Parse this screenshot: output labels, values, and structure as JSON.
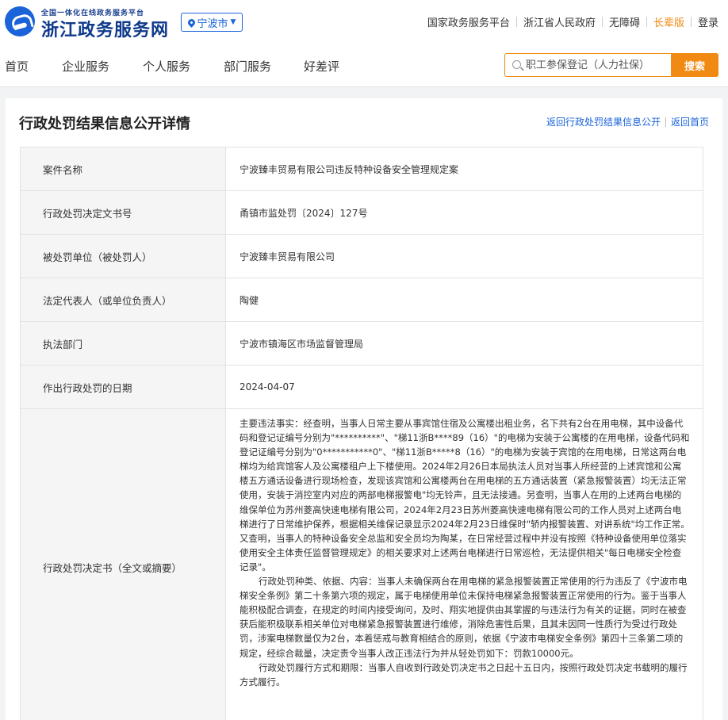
{
  "header": {
    "subtitle": "全国一体化在线政务服务平台",
    "brand": "浙江政务服务网",
    "city": "宁波市",
    "links": [
      "国家政务服务平台",
      "浙江省人民政府",
      "无障碍",
      "长辈版",
      "登录"
    ]
  },
  "nav": {
    "items": [
      "首页",
      "企业服务",
      "个人服务",
      "部门服务",
      "好差评"
    ],
    "search_placeholder": "职工参保登记（人力社保）",
    "search_button": "搜索"
  },
  "page": {
    "title": "行政处罚结果信息公开详情",
    "back_list": "返回行政处罚结果信息公开",
    "back_home": "返回首页"
  },
  "detail": {
    "rows": [
      {
        "label": "案件名称",
        "value": "宁波臻丰贸易有限公司违反特种设备安全管理规定案"
      },
      {
        "label": "行政处罚决定文书号",
        "value": "甬镇市监处罚〔2024〕127号"
      },
      {
        "label": "被处罚单位（被处罚人）",
        "value": "宁波臻丰贸易有限公司"
      },
      {
        "label": "法定代表人（或单位负责人）",
        "value": "陶健"
      },
      {
        "label": "执法部门",
        "value": "宁波市镇海区市场监督管理局"
      },
      {
        "label": "作出行政处罚的日期",
        "value": "2024-04-07"
      }
    ],
    "summary_label": "行政处罚决定书（全文或摘要）",
    "summary_paragraphs": [
      "主要违法事实：经查明，当事人日常主要从事宾馆住宿及公寓楼出租业务，名下共有2台在用电梯，其中设备代码和登记证编号分别为\"**********\"、\"梯11浙B****89（16）\"的电梯为安装于公寓楼的在用电梯，设备代码和登记证编号分别为\"0***********0\"、\"梯11浙B*****8（16）\"的电梯为安装于宾馆的在用电梯，日常这两台电梯均为给宾馆客人及公寓楼租户上下楼使用。2024年2月26日本局执法人员对当事人所经营的上述宾馆和公寓楼五方通话设备进行现场检查，发现该宾馆和公寓楼两台在用电梯的五方通话装置（紧急报警装置）均无法正常使用，安装于消控室内对应的两部电梯报警电\"均无铃声，且无法接通。另查明，当事人在用的上述两台电梯的维保单位为苏州菱高快速电梯有限公司，2024年2月23日苏州菱高快速电梯有限公司的工作人员对上述两台电梯进行了日常维护保养，根据相关维保记录显示2024年2月23日维保时\"轿内报警装置、对讲系统\"均工作正常。又查明，当事人的特种设备安全总监和安全员均为陶某，在日常经营过程中并没有按照《特种设备使用单位落实使用安全主体责任监督管理规定》的相关要求对上述两台电梯进行日常巡检，无法提供相关\"每日电梯安全检查记录\"。",
      "行政处罚种类、依据、内容：当事人未确保两台在用电梯的紧急报警装置正常使用的行为违反了《宁波市电梯安全条例》第二十条第六项的规定，属于电梯使用单位未保持电梯紧急报警装置正常使用的行为。鉴于当事人能积极配合调查，在规定的时间内接受询问，及时、翔实地提供由其掌握的与违法行为有关的证据，同时在被查获后能积极联系相关单位对电梯紧急报警装置进行维修，消除危害性后果，且其未因同一性质行为受过行政处罚，涉案电梯数量仅为2台，本着惩戒与教育相结合的原则，依据《宁波市电梯安全条例》第四十三条第二项的规定，经综合裁量，决定责令当事人改正违法行为并从轻处罚如下：罚款10000元。",
      "行政处罚履行方式和期限：当事人自收到行政处罚决定书之日起十五日内，按照行政处罚决定书载明的履行方式履行。"
    ]
  }
}
